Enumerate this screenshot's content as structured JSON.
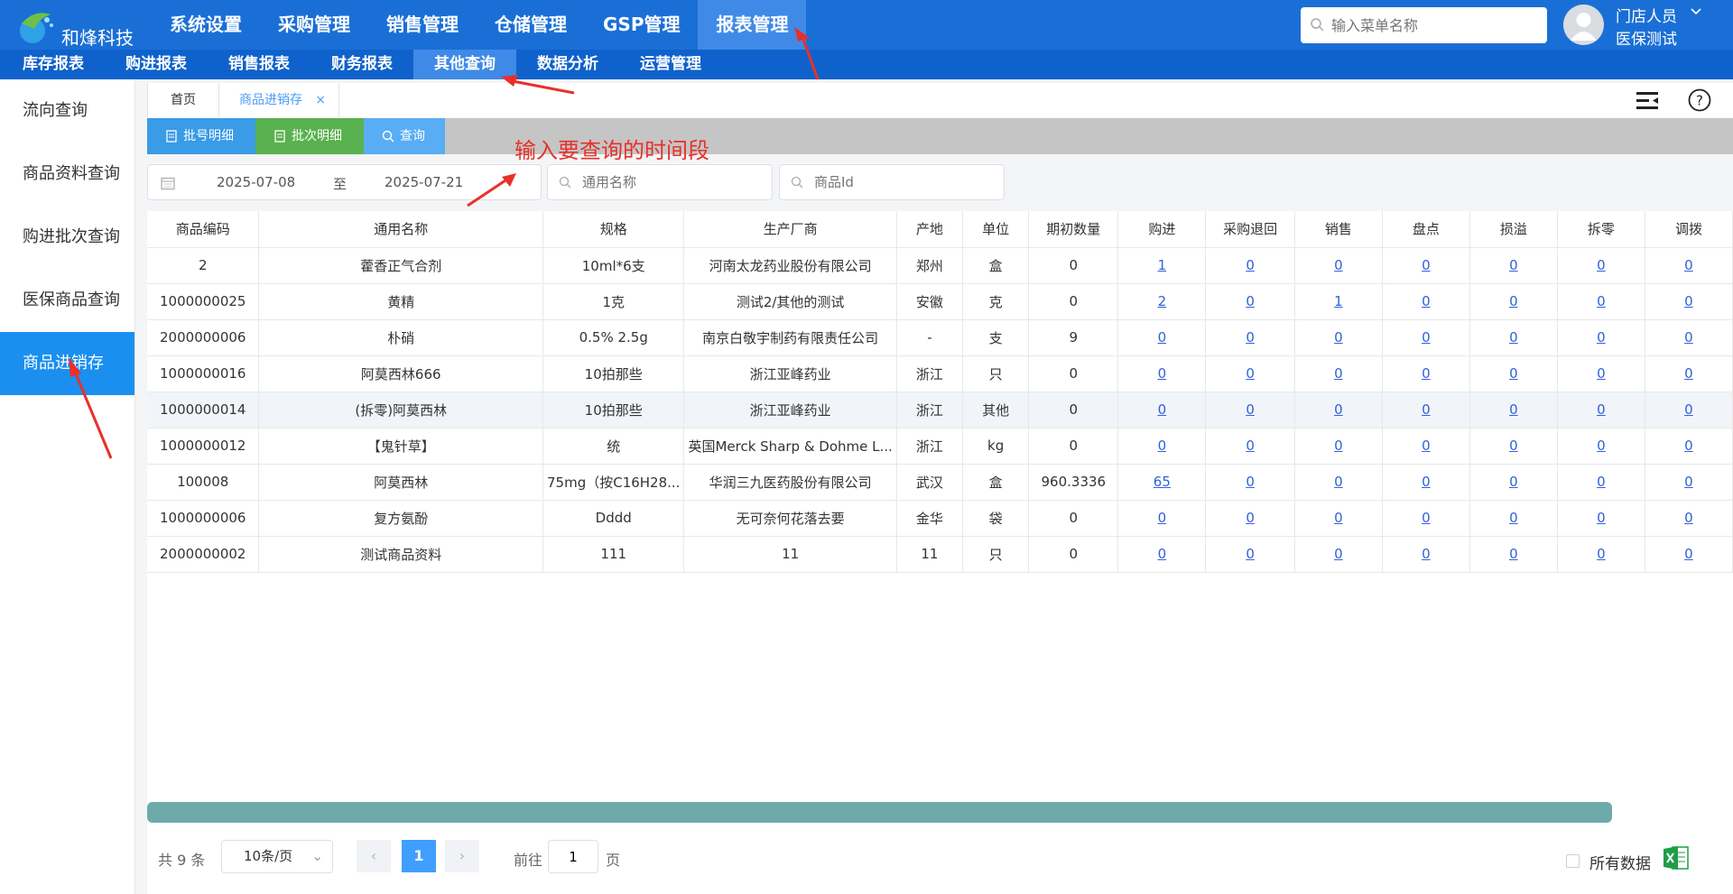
{
  "brand": {
    "name": "和烽科技"
  },
  "topnav": [
    {
      "label": "系统设置",
      "active": false
    },
    {
      "label": "采购管理",
      "active": false
    },
    {
      "label": "销售管理",
      "active": false
    },
    {
      "label": "仓储管理",
      "active": false
    },
    {
      "label": "GSP管理",
      "active": false
    },
    {
      "label": "报表管理",
      "active": true
    }
  ],
  "menu_search": {
    "placeholder": "输入菜单名称"
  },
  "user": {
    "name": "门店人员",
    "role": "医保测试"
  },
  "subnav": [
    {
      "label": "库存报表",
      "active": false
    },
    {
      "label": "购进报表",
      "active": false
    },
    {
      "label": "销售报表",
      "active": false
    },
    {
      "label": "财务报表",
      "active": false
    },
    {
      "label": "其他查询",
      "active": true
    },
    {
      "label": "数据分析",
      "active": false
    },
    {
      "label": "运营管理",
      "active": false
    }
  ],
  "sidebar": [
    {
      "label": "流向查询",
      "active": false
    },
    {
      "label": "商品资料查询",
      "active": false
    },
    {
      "label": "购进批次查询",
      "active": false
    },
    {
      "label": "医保商品查询",
      "active": false
    },
    {
      "label": "商品进销存",
      "active": true
    }
  ],
  "tabs": {
    "home": "首页",
    "active": "商品进销存",
    "close": "×"
  },
  "toolbar": {
    "batchno": "批号明细",
    "batch": "批次明细",
    "query": "查询"
  },
  "annotation": {
    "text": "输入要查询的时间段"
  },
  "filters": {
    "date_start": "2025-07-08",
    "date_sep": "至",
    "date_end": "2025-07-21",
    "name_placeholder": "通用名称",
    "id_placeholder": "商品Id"
  },
  "table": {
    "columns": [
      "商品编码",
      "通用名称",
      "规格",
      "生产厂商",
      "产地",
      "单位",
      "期初数量",
      "购进",
      "采购退回",
      "销售",
      "盘点",
      "损溢",
      "拆零",
      "调拨"
    ],
    "rows": [
      [
        "2",
        "藿香正气合剂",
        "10ml*6支",
        "河南太龙药业股份有限公司",
        "郑州",
        "盒",
        "0",
        "1",
        "0",
        "0",
        "0",
        "0",
        "0",
        "0"
      ],
      [
        "1000000025",
        "黄精",
        "1克",
        "测试2/其他的测试",
        "安徽",
        "克",
        "0",
        "2",
        "0",
        "1",
        "0",
        "0",
        "0",
        "0"
      ],
      [
        "2000000006",
        "朴硝",
        "0.5% 2.5g",
        "南京白敬宇制药有限责任公司",
        "-",
        "支",
        "9",
        "0",
        "0",
        "0",
        "0",
        "0",
        "0",
        "0"
      ],
      [
        "1000000016",
        "阿莫西林666",
        "10拍那些",
        "浙江亚峰药业",
        "浙江",
        "只",
        "0",
        "0",
        "0",
        "0",
        "0",
        "0",
        "0",
        "0"
      ],
      [
        "1000000014",
        "(拆零)阿莫西林",
        "10拍那些",
        "浙江亚峰药业",
        "浙江",
        "其他",
        "0",
        "0",
        "0",
        "0",
        "0",
        "0",
        "0",
        "0"
      ],
      [
        "1000000012",
        "【鬼针草】",
        "统",
        "英国Merck Sharp & Dohme L...",
        "浙江",
        "kg",
        "0",
        "0",
        "0",
        "0",
        "0",
        "0",
        "0",
        "0"
      ],
      [
        "100008",
        "阿莫西林",
        "75mg（按C16H28...",
        "华润三九医药股份有限公司",
        "武汉",
        "盒",
        "960.3336",
        "65",
        "0",
        "0",
        "0",
        "0",
        "0",
        "0"
      ],
      [
        "1000000006",
        "复方氨酚",
        "Dddd",
        "无可奈何花落去要",
        "金华",
        "袋",
        "0",
        "0",
        "0",
        "0",
        "0",
        "0",
        "0",
        "0"
      ],
      [
        "2000000002",
        "测试商品资料",
        "111",
        "11",
        "11",
        "只",
        "0",
        "0",
        "0",
        "0",
        "0",
        "0",
        "0",
        "0"
      ]
    ]
  },
  "pager": {
    "total": "共 9 条",
    "page_size": "10条/页",
    "prev": "‹",
    "current": "1",
    "next": "›",
    "goto_label": "前往",
    "goto_value": "1",
    "page_unit": "页"
  },
  "export": {
    "all_data_label": "所有数据"
  },
  "colors": {
    "topbar": "#1a6fd6",
    "subnav": "#0f62cc",
    "active_nav": "#3f8ae6",
    "sidebar_active": "#1a8ff0",
    "annotation": "#e8302a"
  }
}
